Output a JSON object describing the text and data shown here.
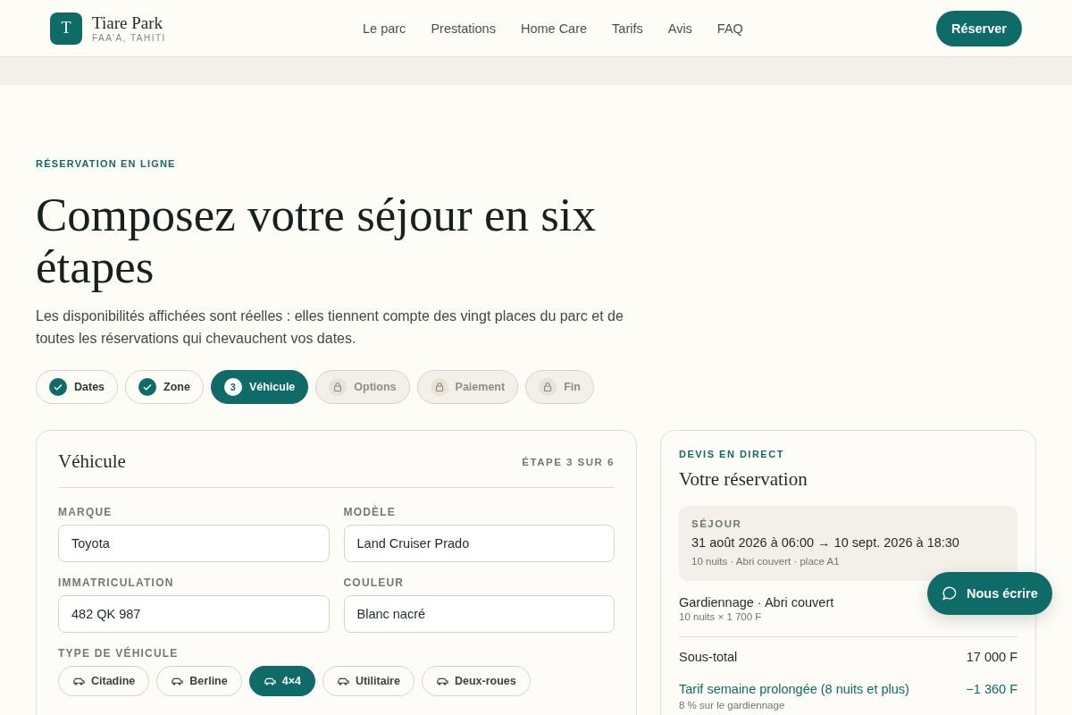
{
  "brand": {
    "logo_letter": "T",
    "name": "Tiare Park",
    "location": "FAA’A, TAHITI"
  },
  "nav": [
    "Le parc",
    "Prestations",
    "Home Care",
    "Tarifs",
    "Avis",
    "FAQ"
  ],
  "cta": "Réserver",
  "eyebrow": "RÉSERVATION EN LIGNE",
  "title": "Composez votre séjour en six étapes",
  "intro": "Les disponibilités affichées sont réelles : elles tiennent compte des vingt places du parc et de toutes les réservations qui chevauchent vos dates.",
  "steps": [
    {
      "label": "Dates",
      "kind": "done",
      "selected": false
    },
    {
      "label": "Zone",
      "kind": "done",
      "selected": false
    },
    {
      "label": "Véhicule",
      "kind": "current",
      "number": "3",
      "selected": true
    },
    {
      "label": "Options",
      "kind": "locked",
      "selected": false
    },
    {
      "label": "Paiement",
      "kind": "locked",
      "selected": false
    },
    {
      "label": "Fin",
      "kind": "locked",
      "selected": false
    }
  ],
  "vehicle_card": {
    "title": "Véhicule",
    "step": "ÉTAPE 3 SUR 6",
    "fields": [
      {
        "label": "MARQUE",
        "value": "Toyota"
      },
      {
        "label": "MODÈLE",
        "value": "Land Cruiser Prado"
      },
      {
        "label": "IMMATRICULATION",
        "value": "482 QK 987"
      },
      {
        "label": "COULEUR",
        "value": "Blanc nacré"
      }
    ],
    "type_label": "TYPE DE VÉHICULE",
    "types": [
      {
        "label": "Citadine",
        "selected": false
      },
      {
        "label": "Berline",
        "selected": false
      },
      {
        "label": "4×4",
        "selected": true
      },
      {
        "label": "Utilitaire",
        "selected": false
      },
      {
        "label": "Deux-roues",
        "selected": false
      }
    ]
  },
  "quote": {
    "eyebrow": "DEVIS EN DIRECT",
    "title": "Votre réservation",
    "stay": {
      "label": "SÉJOUR",
      "dates": "31 août 2026 à 06:00 → 10 sept. 2026 à 18:30",
      "details": "10 nuits · Abri couvert · place A1"
    },
    "item": {
      "name": "Gardiennage · Abri couvert",
      "detail": "10 nuits × 1 700 F"
    },
    "subtotal": {
      "label": "Sous-total",
      "amount": "17 000 F"
    },
    "discount": {
      "label": "Tarif semaine prolongée (8 nuits et plus)",
      "amount": "−1 360 F",
      "detail": "8 % sur le gardiennage"
    }
  },
  "chat_button": "Nous écrire"
}
